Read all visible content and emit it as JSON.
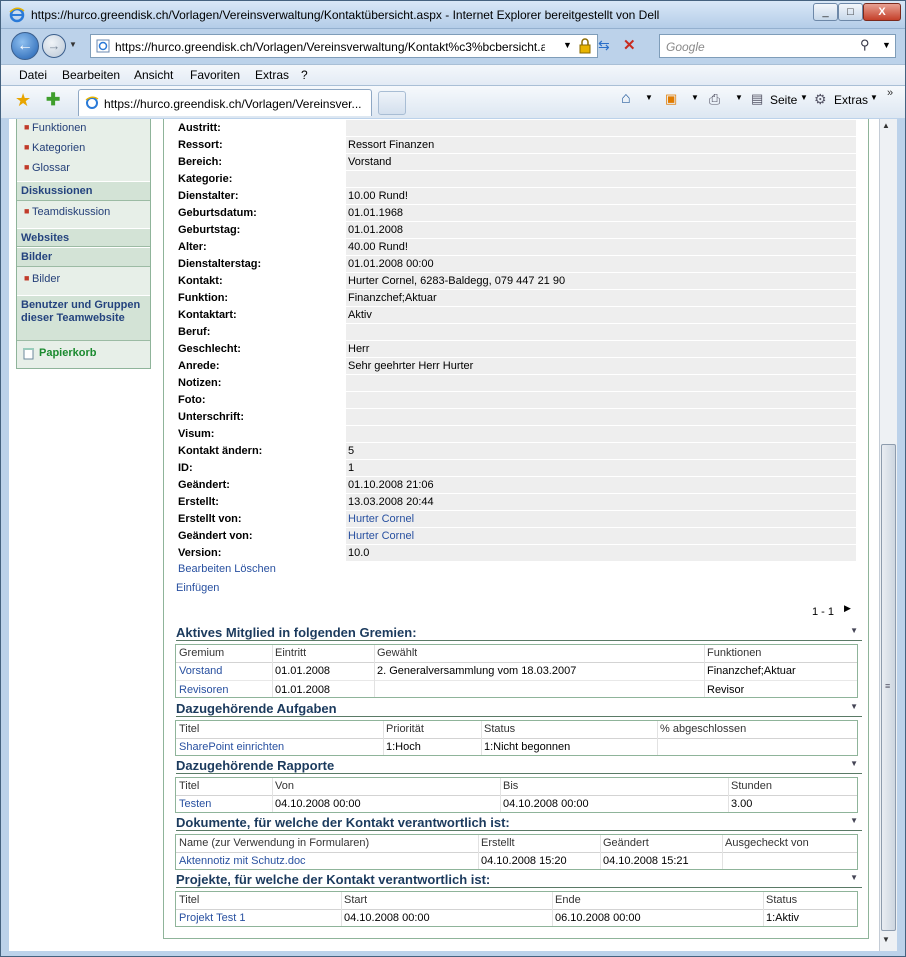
{
  "window": {
    "title": "https://hurco.greendisk.ch/Vorlagen/Vereinsverwaltung/Kontaktübersicht.aspx - Internet Explorer bereitgestellt von Dell",
    "min": "_",
    "max": "□",
    "close": "X"
  },
  "nav": {
    "address": "https://hurco.greendisk.ch/Vorlagen/Vereinsverwaltung/Kontakt%c3%bcbersicht.as",
    "search_placeholder": "Google"
  },
  "menu": [
    "Datei",
    "Bearbeiten",
    "Ansicht",
    "Favoriten",
    "Extras",
    "?"
  ],
  "tab": {
    "label": "https://hurco.greendisk.ch/Vorlagen/Vereinsver..."
  },
  "commands": {
    "page": "Seite",
    "tools": "Extras"
  },
  "leftnav": {
    "items_top": [
      "Funktionen",
      "Kategorien",
      "Glossar"
    ],
    "discussions_head": "Diskussionen",
    "discussions": [
      "Teamdiskussion"
    ],
    "websites_head": "Websites",
    "pictures_head": "Bilder",
    "pictures": [
      "Bilder"
    ],
    "users_head": "Benutzer und Gruppen dieser Teamwebsite",
    "recycle": "Papierkorb"
  },
  "fields": [
    {
      "label": "Austritt:",
      "value": ""
    },
    {
      "label": "Ressort:",
      "value": "Ressort Finanzen"
    },
    {
      "label": "Bereich:",
      "value": "Vorstand"
    },
    {
      "label": "Kategorie:",
      "value": ""
    },
    {
      "label": "Dienstalter:",
      "value": "10.00 Rund!"
    },
    {
      "label": "Geburtsdatum:",
      "value": "01.01.1968"
    },
    {
      "label": "Geburtstag:",
      "value": "01.01.2008"
    },
    {
      "label": "Alter:",
      "value": "40.00 Rund!"
    },
    {
      "label": "Dienstalterstag:",
      "value": "01.01.2008 00:00"
    },
    {
      "label": "Kontakt:",
      "value": "Hurter Cornel, 6283-Baldegg, 079 447 21 90"
    },
    {
      "label": "Funktion:",
      "value": "Finanzchef;Aktuar"
    },
    {
      "label": "Kontaktart:",
      "value": "Aktiv"
    },
    {
      "label": "Beruf:",
      "value": ""
    },
    {
      "label": "Geschlecht:",
      "value": "Herr"
    },
    {
      "label": "Anrede:",
      "value": "Sehr geehrter Herr Hurter"
    },
    {
      "label": "Notizen:",
      "value": ""
    },
    {
      "label": "Foto:",
      "value": ""
    },
    {
      "label": "Unterschrift:",
      "value": ""
    },
    {
      "label": "Visum:",
      "value": ""
    },
    {
      "label": "Kontakt ändern:",
      "value": "5"
    },
    {
      "label": "ID:",
      "value": "1"
    },
    {
      "label": "Geändert:",
      "value": "01.10.2008 21:06"
    },
    {
      "label": "Erstellt:",
      "value": "13.03.2008 20:44"
    },
    {
      "label": "Erstellt von:",
      "value": "Hurter Cornel"
    },
    {
      "label": "Geändert von:",
      "value": "Hurter Cornel"
    },
    {
      "label": "Version:",
      "value": "10.0"
    }
  ],
  "actions": {
    "edit_delete": "Bearbeiten Löschen",
    "insert": "Einfügen",
    "paging": "1 - 1"
  },
  "sections": {
    "gremien": {
      "title": "Aktives Mitglied in folgenden Gremien:",
      "headers": [
        "Gremium",
        "Eintritt",
        "Gewählt",
        "Funktionen"
      ],
      "rows": [
        [
          "Vorstand",
          "01.01.2008",
          "2. Generalversammlung vom 18.03.2007",
          "Finanzchef;Aktuar"
        ],
        [
          "Revisoren",
          "01.01.2008",
          "",
          "Revisor"
        ]
      ]
    },
    "aufgaben": {
      "title": "Dazugehörende Aufgaben",
      "headers": [
        "Titel",
        "Priorität",
        "Status",
        "% abgeschlossen"
      ],
      "rows": [
        [
          "SharePoint einrichten",
          "1:Hoch",
          "1:Nicht begonnen",
          ""
        ]
      ]
    },
    "rapporte": {
      "title": "Dazugehörende Rapporte",
      "headers": [
        "Titel",
        "Von",
        "Bis",
        "Stunden"
      ],
      "rows": [
        [
          "Testen",
          "04.10.2008 00:00",
          "04.10.2008 00:00",
          "3.00"
        ]
      ]
    },
    "dokumente": {
      "title": "Dokumente, für welche der Kontakt verantwortlich ist:",
      "headers": [
        "Name (zur Verwendung in Formularen)",
        "Erstellt",
        "Geändert",
        "Ausgecheckt von"
      ],
      "rows": [
        [
          "Aktennotiz mit Schutz.doc",
          "04.10.2008 15:20",
          "04.10.2008 15:21",
          ""
        ]
      ]
    },
    "projekte": {
      "title": "Projekte, für welche der Kontakt verantwortlich ist:",
      "headers": [
        "Titel",
        "Start",
        "Ende",
        "Status"
      ],
      "rows": [
        [
          "Projekt Test 1",
          "04.10.2008 00:00",
          "06.10.2008 00:00",
          "1:Aktiv"
        ]
      ]
    }
  },
  "colors": {
    "link": "#2850a0",
    "nav_bullet": "#c13b2a",
    "recycle": "#1b8a2f"
  }
}
